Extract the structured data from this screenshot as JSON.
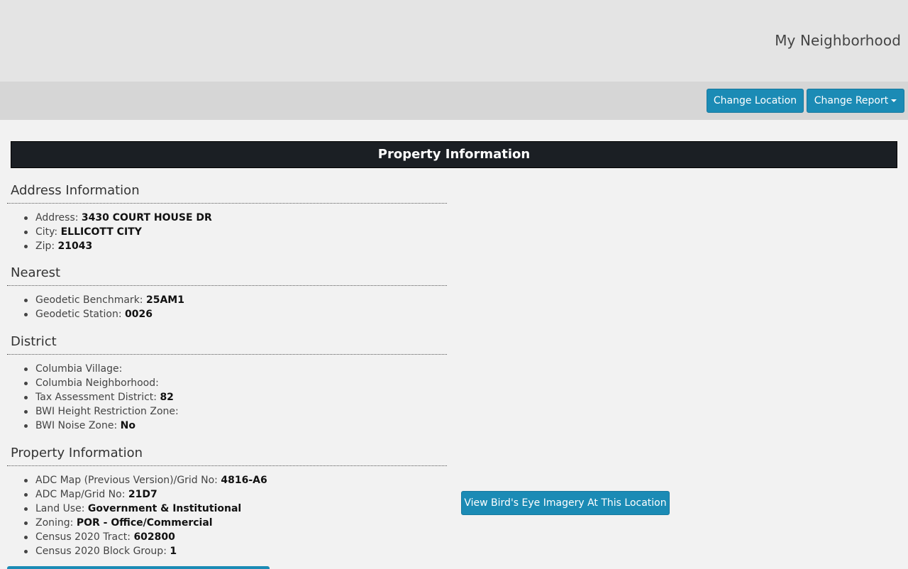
{
  "header": {
    "app_title": "My Neighborhood"
  },
  "toolbar": {
    "change_location_label": "Change Location",
    "change_report_label": "Change Report"
  },
  "main": {
    "title": "Property Information",
    "birdseye_label": "View Bird's Eye Imagery At This Location",
    "sections": {
      "address": {
        "title": "Address Information",
        "items": [
          {
            "label": "Address: ",
            "value": "3430 COURT HOUSE DR"
          },
          {
            "label": "City: ",
            "value": "ELLICOTT CITY"
          },
          {
            "label": "Zip: ",
            "value": "21043"
          }
        ]
      },
      "nearest": {
        "title": "Nearest",
        "items": [
          {
            "label": "Geodetic Benchmark: ",
            "value": "25AM1"
          },
          {
            "label": "Geodetic Station: ",
            "value": "0026"
          }
        ]
      },
      "district": {
        "title": "District",
        "items": [
          {
            "label": "Columbia Village:",
            "value": ""
          },
          {
            "label": "Columbia Neighborhood:",
            "value": ""
          },
          {
            "label": "Tax Assessment District: ",
            "value": "82"
          },
          {
            "label": "BWI Height Restriction Zone:",
            "value": ""
          },
          {
            "label": "BWI Noise Zone: ",
            "value": "No"
          }
        ]
      },
      "property": {
        "title": "Property Information",
        "items": [
          {
            "label": "ADC Map (Previous Version)/Grid No: ",
            "value": "4816-A6"
          },
          {
            "label": "ADC Map/Grid No: ",
            "value": "21D7"
          },
          {
            "label": "Land Use: ",
            "value": "Government & Institutional"
          },
          {
            "label": "Zoning: ",
            "value": "POR - Office/Commercial"
          },
          {
            "label": "Census 2020 Tract: ",
            "value": "602800"
          },
          {
            "label": "Census 2020 Block Group: ",
            "value": "1"
          }
        ]
      }
    }
  },
  "colors": {
    "accent": "#1b8bb5",
    "header_bar": "#1b1f24"
  }
}
